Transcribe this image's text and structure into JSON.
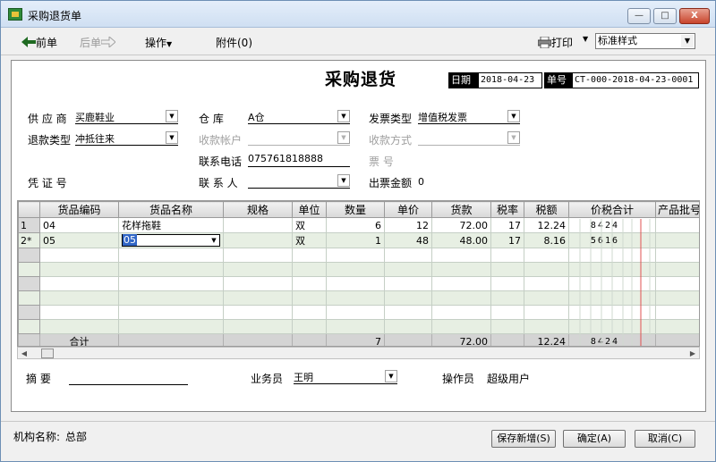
{
  "window": {
    "title": "采购退货单",
    "min_glyph": "—",
    "max_glyph": "□",
    "close_glyph": "X"
  },
  "toolbar": {
    "prev_label": "前单",
    "next_label": "后单",
    "operate_label": "操作",
    "attach_label": "附件(0)",
    "print_label": "打印",
    "style_value": "标准样式"
  },
  "doc": {
    "title": "采购退货",
    "date_label": "日期",
    "date_value": "2018-04-23",
    "no_label": "单号",
    "no_value": "CT-000-2018-04-23-0001"
  },
  "form": {
    "supplier_label": "供 应 商",
    "supplier_value": "买鹿鞋业",
    "warehouse_label": "仓     库",
    "warehouse_value": "A仓",
    "invoice_type_label": "发票类型",
    "invoice_type_value": "增值税发票",
    "refund_type_label": "退款类型",
    "refund_type_value": "冲抵往来",
    "account_label": "收款帐户",
    "account_value": "",
    "pay_method_label": "收款方式",
    "pay_method_value": "",
    "phone_label": "联系电话",
    "phone_value": "075761818888",
    "ticket_label": "票     号",
    "voucher_label": "凭 证 号",
    "contact_label": "联 系 人",
    "contact_value": "",
    "invoice_amount_label": "出票金额",
    "invoice_amount_value": "0"
  },
  "grid": {
    "columns": [
      "货品编码",
      "货品名称",
      "规格",
      "单位",
      "数量",
      "单价",
      "货款",
      "税率",
      "税额",
      "价税合计",
      "产品批号"
    ],
    "rows": [
      {
        "header": "1",
        "code": "04",
        "name": "花样拖鞋",
        "spec": "",
        "unit": "双",
        "qty": "6",
        "price": "12",
        "amount": "72.00",
        "tax_rate": "17",
        "tax": "12.24",
        "total": "8424",
        "batch": ""
      },
      {
        "header": "2*",
        "code": "05",
        "name": "05",
        "spec": "",
        "unit": "双",
        "qty": "1",
        "price": "48",
        "amount": "48.00",
        "tax_rate": "17",
        "tax": "8.16",
        "total": "5616",
        "batch": ""
      }
    ],
    "total_row": {
      "label": "合计",
      "qty": "7",
      "amount": "72.00",
      "tax": "12.24",
      "total": "8424"
    }
  },
  "footer": {
    "memo_label": "摘  要",
    "memo_value": "",
    "salesman_label": "业务员",
    "salesman_value": "王明",
    "operator_label": "操作员",
    "operator_value": "超级用户"
  },
  "status": {
    "org_label": "机构名称:",
    "org_value": "总部"
  },
  "buttons": {
    "save_new": "保存新增(S)",
    "ok": "确定(A)",
    "cancel": "取消(C)"
  }
}
